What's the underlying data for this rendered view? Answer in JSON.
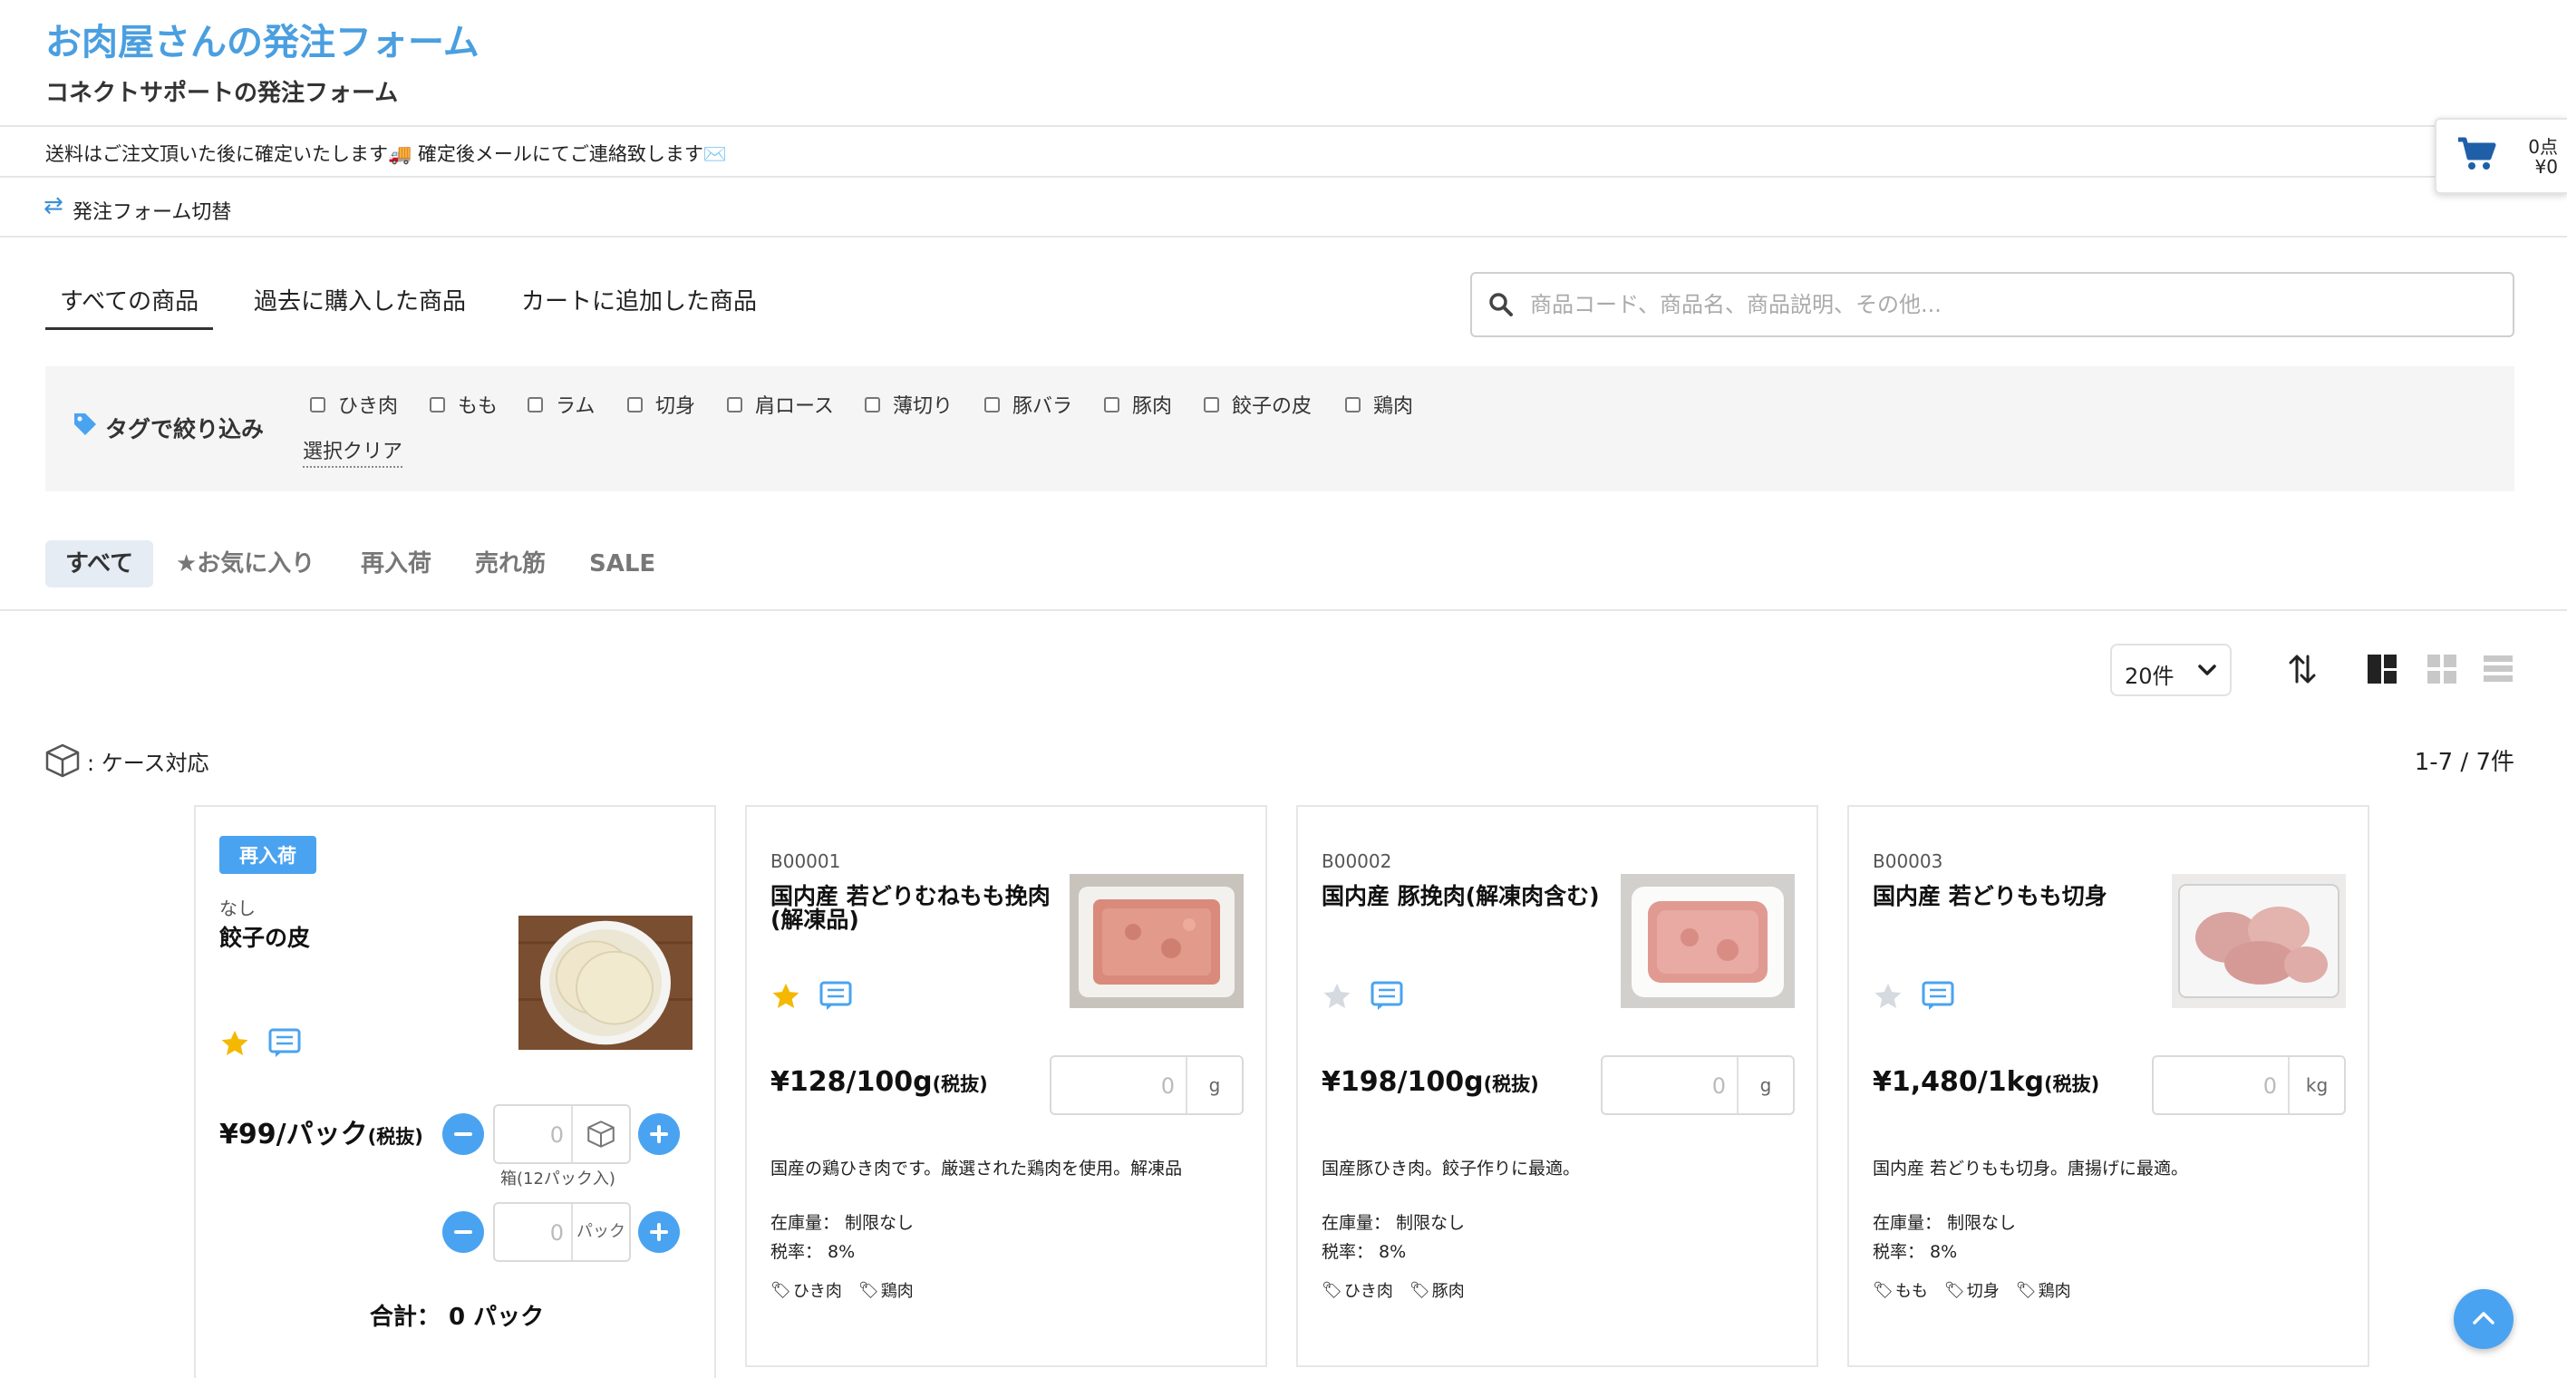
{
  "header": {
    "title": "お肉屋さんの発注フォーム",
    "subtitle": "コネクトサポートの発注フォーム"
  },
  "notice": "送料はご注文頂いた後に確定いたします🚚 確定後メールにてご連絡致します✉️",
  "switch_label": "発注フォーム切替",
  "cart": {
    "count": "0点",
    "total": "¥0"
  },
  "top_tabs": [
    "すべての商品",
    "過去に購入した商品",
    "カートに追加した商品"
  ],
  "search": {
    "placeholder": "商品コード、商品名、商品説明、その他..."
  },
  "tag_filter": {
    "title": "タグで絞り込み",
    "tags": [
      "ひき肉",
      "もも",
      "ラム",
      "切身",
      "肩ロース",
      "薄切り",
      "豚バラ",
      "豚肉",
      "餃子の皮",
      "鶏肉"
    ],
    "clear": "選択クリア"
  },
  "filter_tabs": [
    "すべて",
    "★お気に入り",
    "再入荷",
    "売れ筋",
    "SALE"
  ],
  "toolbar": {
    "per_page": "20件"
  },
  "case_legend": ": ケース対応",
  "result_count": "1-7 / 7件",
  "products": [
    {
      "badge": "再入荷",
      "code": "なし",
      "name": "餃子の皮",
      "favorite": true,
      "price": "¥99/パック",
      "tax_note": "(税抜)",
      "case_qty": "0",
      "case_note": "箱(12パック入)",
      "pack_qty": "0",
      "pack_unit": "パック",
      "total_label": "合計：",
      "total_value": "0 パック"
    },
    {
      "code": "B00001",
      "name": "国内産 若どりむねもも挽肉(解凍品)",
      "favorite": true,
      "price": "¥128/100g",
      "tax_note": "(税抜)",
      "qty": "0",
      "unit": "g",
      "description": "国産の鶏ひき肉です。厳選された鶏肉を使用。解凍品",
      "stock": "在庫量： 制限なし",
      "tax": "税率： 8%",
      "tags": [
        "ひき肉",
        "鶏肉"
      ]
    },
    {
      "code": "B00002",
      "name": "国内産 豚挽肉(解凍肉含む)",
      "favorite": false,
      "price": "¥198/100g",
      "tax_note": "(税抜)",
      "qty": "0",
      "unit": "g",
      "description": "国産豚ひき肉。餃子作りに最適。",
      "stock": "在庫量： 制限なし",
      "tax": "税率： 8%",
      "tags": [
        "ひき肉",
        "豚肉"
      ]
    },
    {
      "code": "B00003",
      "name": "国内産 若どりもも切身",
      "favorite": false,
      "price": "¥1,480/1kg",
      "tax_note": "(税抜)",
      "qty": "0",
      "unit": "kg",
      "description": "国内産 若どりもも切身。唐揚げに最適。",
      "stock": "在庫量： 制限なし",
      "tax": "税率： 8%",
      "tags": [
        "もも",
        "切身",
        "鶏肉"
      ]
    }
  ],
  "colors": {
    "accent": "#4aa3f0",
    "title": "#4a9fe0",
    "star_on": "#f5b800",
    "star_off": "#d5d9e0",
    "cart_icon": "#1f5fa8"
  }
}
